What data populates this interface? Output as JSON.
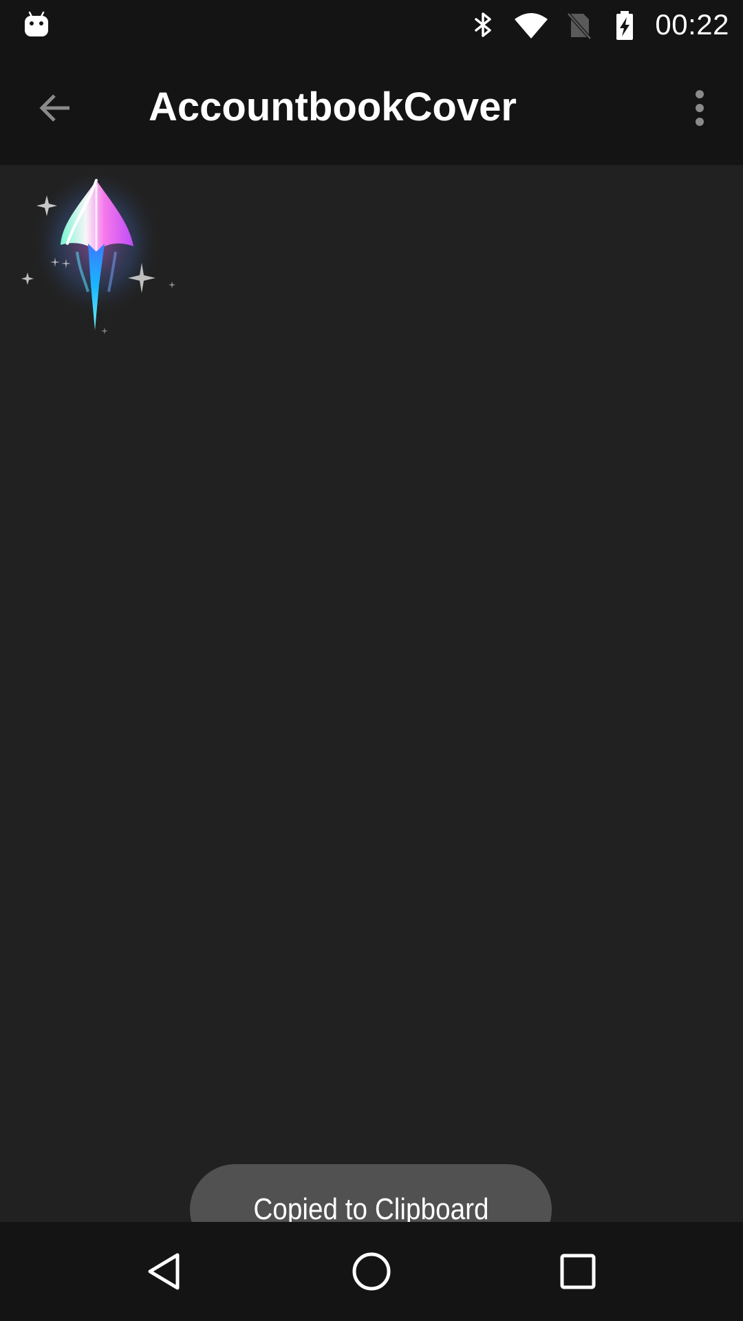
{
  "status_bar": {
    "time": "00:22",
    "icons": [
      "android-notification-icon",
      "bluetooth-icon",
      "wifi-icon",
      "no-sim-icon",
      "battery-charging-icon"
    ]
  },
  "app_bar": {
    "title": "AccountbookCover",
    "back_icon": "arrow-back-icon",
    "overflow_icon": "more-vertical-icon"
  },
  "content": {
    "image": "sparkle-rocket-cover-image"
  },
  "toast": {
    "message": "Copied to Clipboard"
  },
  "nav_bar": {
    "icons": [
      "back-triangle-icon",
      "home-circle-icon",
      "recents-square-icon"
    ]
  }
}
